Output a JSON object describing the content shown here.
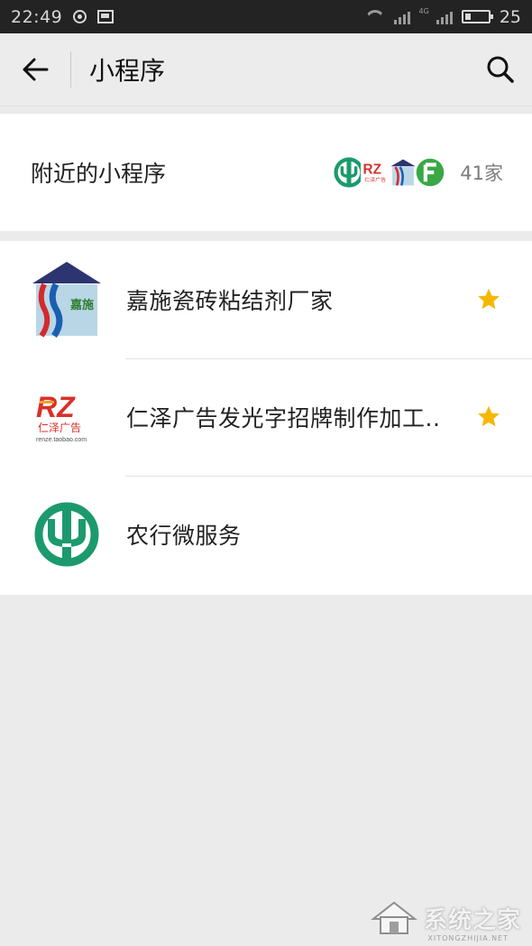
{
  "status_bar": {
    "time": "22:49",
    "signal_tag": "4G",
    "battery_level": "25"
  },
  "header": {
    "title": "小程序",
    "back_icon": "arrow-left-icon",
    "search_icon": "search-icon"
  },
  "nearby": {
    "label": "附近的小程序",
    "count": "41家"
  },
  "mini_programs": [
    {
      "name": "嘉施瓷砖粘结剂厂家",
      "starred": true,
      "logo": "jiashi-logo"
    },
    {
      "name": "仁泽广告发光字招牌制作加工..",
      "starred": true,
      "logo": "renze-logo"
    },
    {
      "name": "农行微服务",
      "starred": false,
      "logo": "abc-bank-logo"
    }
  ],
  "logo_text": {
    "jiashi": "嘉施",
    "renze_mark": "RZ",
    "renze_name": "仁泽广告",
    "renze_url": "renze.taobao.com"
  },
  "watermark": {
    "text": "系统之家",
    "url": "XITONGZHIJIA.NET"
  },
  "colors": {
    "star": "#f5b800",
    "abc_green": "#1c9a6e",
    "renze_red": "#d8302b"
  }
}
